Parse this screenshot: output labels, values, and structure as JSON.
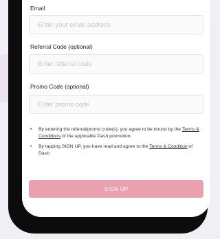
{
  "form": {
    "email": {
      "label": "Email",
      "placeholder": "Enter your email address"
    },
    "referral": {
      "label": "Referral Code (optional)",
      "placeholder": "Enter referral code"
    },
    "promo": {
      "label": "Promo Code (optional)",
      "placeholder": "Enter promo code"
    }
  },
  "notes": [
    {
      "bullet": "•",
      "before": "By entering the referral/promo code(s), you agree to be bound by the",
      "link": "Terms & Conditions",
      "after": "of the applicable Dash promotion."
    },
    {
      "bullet": "•",
      "before": "By tapping SIGN UP, you have read and agree to the",
      "link": "Terms & Condition",
      "after": "of Dash."
    }
  ],
  "signup_button": {
    "label": "SIGN UP"
  },
  "colors": {
    "button_bg": "#eaa0ae",
    "background": "#f1eef4"
  }
}
